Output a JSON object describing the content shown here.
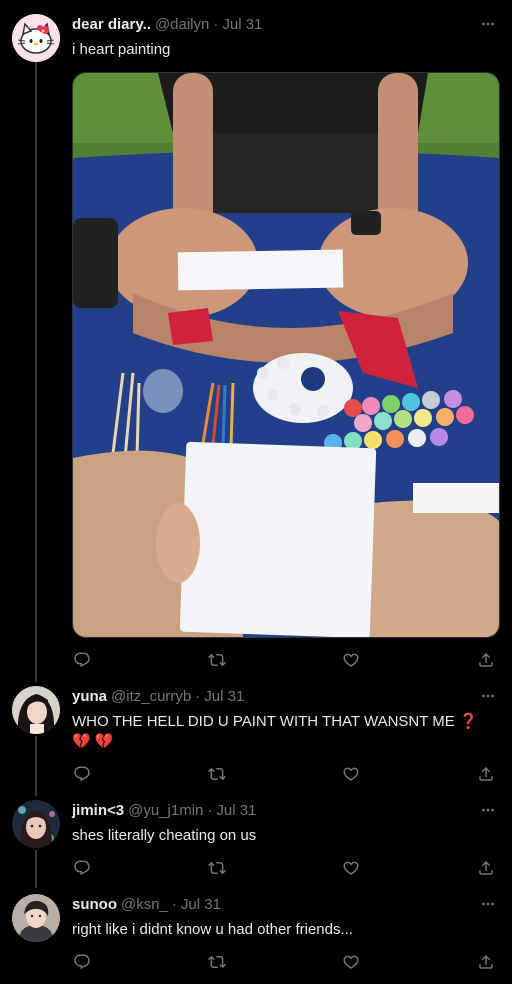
{
  "tweets": [
    {
      "name": "dear diary..",
      "handle": "@dailyn",
      "date": "Jul 31",
      "text": "i heart painting",
      "avatar_icon": "hello-kitty-icon"
    },
    {
      "name": "yuna",
      "handle": "@itz_curryb",
      "date": "Jul 31",
      "text": "WHO THE HELL DID U PAINT WITH THAT WANSNT ME ❓💔 💔",
      "avatar_icon": "avatar-photo"
    },
    {
      "name": "jimin<3",
      "handle": "@yu_j1min",
      "date": "Jul 31",
      "text": "shes literally cheating on us",
      "avatar_icon": "avatar-photo"
    },
    {
      "name": "sunoo",
      "handle": "@ksn_",
      "date": "Jul 31",
      "text": "right like i didnt know u had other friends...",
      "avatar_icon": "avatar-photo"
    }
  ],
  "separator": "·",
  "colors": {
    "background": "#000000",
    "text": "#e7e9ea",
    "muted": "#71767b",
    "thread_line": "#333639"
  },
  "icons": [
    "more-icon",
    "reply-icon",
    "retweet-icon",
    "like-icon",
    "share-icon"
  ]
}
